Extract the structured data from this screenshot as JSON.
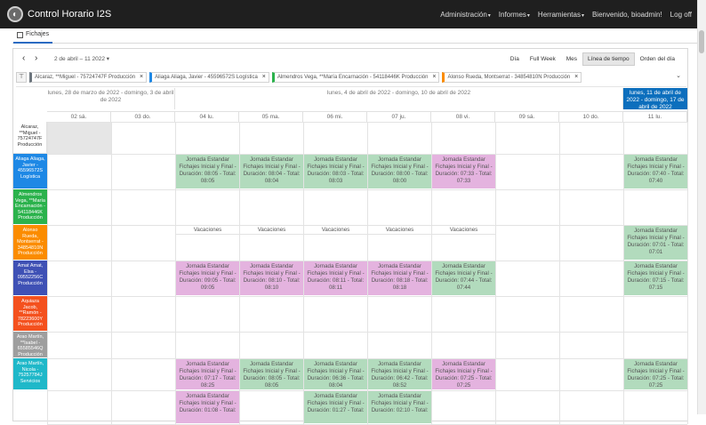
{
  "app": {
    "title": "Control Horario I2S"
  },
  "nav": [
    {
      "label": "Administración",
      "has_caret": true
    },
    {
      "label": "Informes",
      "has_caret": true
    },
    {
      "label": "Herramientas",
      "has_caret": true
    },
    {
      "label": "Bienvenido, bioadmin!",
      "has_caret": false
    },
    {
      "label": "Log off",
      "has_caret": false
    }
  ],
  "tabs": [
    {
      "label": "Fichajes",
      "icon": "clipboard-icon"
    }
  ],
  "toolbar": {
    "prev": "‹",
    "next": "›",
    "date_range": "2 de abril – 11 2022",
    "views": [
      {
        "label": "Día",
        "active": false
      },
      {
        "label": "Full Week",
        "active": false
      },
      {
        "label": "Mes",
        "active": false
      },
      {
        "label": "Línea de tiempo",
        "active": true
      },
      {
        "label": "Orden del día",
        "active": false
      }
    ]
  },
  "filters": [
    {
      "label": "Alcaraz, **Miguel - 75724747F Producción",
      "color": "#6c757d"
    },
    {
      "label": "Aliaga Aliaga, Javier - 45596572S Logística",
      "color": "#1e88e5"
    },
    {
      "label": "Almendros Vega, **María Encarnación - 54118446K Producción",
      "color": "#2bb24c"
    },
    {
      "label": "Alonso Rueda, Montserrat - 34854810N Producción",
      "color": "#fb8c00"
    }
  ],
  "weeks": [
    {
      "label": "lunes, 28 de marzo de 2022 - domingo, 3 de abril de 2022",
      "current": false
    },
    {
      "label": "lunes, 4 de abril de 2022 - domingo, 10 de abril de 2022",
      "current": false
    },
    {
      "label": "lunes, 11 de abril de 2022 - domingo, 17 de abril de 2022",
      "current": true
    }
  ],
  "days": [
    "02 sá.",
    "03 do.",
    "04 lu.",
    "05 ma.",
    "06 mi.",
    "07 ju.",
    "08 vi.",
    "09 sá.",
    "10 do.",
    "11 lu."
  ],
  "resources": [
    {
      "label": "Alcaraz, **Miguel - 75724747F Producción",
      "color": "#ffffff",
      "plain": true
    },
    {
      "label": "Aliaga Aliaga, Javier - 45596572S Logística",
      "color": "#1e88e5",
      "plain": false
    },
    {
      "label": "Almendros Vega, **María Encarnación - 54118446K Producción",
      "color": "#2bb24c",
      "plain": false
    },
    {
      "label": "Alonso Rueda, Montserrat - 34854810N Producción",
      "color": "#fb8c00",
      "plain": false
    },
    {
      "label": "Amat Amat, Elsa - 09552256C Producción",
      "color": "#3f51b5",
      "plain": false
    },
    {
      "label": "Aquiaza Jacob, **Ramón - 78223600Y Producción",
      "color": "#f4511e",
      "plain": false
    },
    {
      "label": "Arao Martín, **Isabel - 65585546Q Producción",
      "color": "#9e9e9e",
      "plain": false
    },
    {
      "label": "Arao Martín, Nicola - 75257784J Servicios",
      "color": "#1fb8c9",
      "plain": false
    }
  ],
  "events": [
    {
      "row": 1,
      "day": 2,
      "color": "green",
      "lines": [
        "Jornada Estandar",
        "Fichajes Inicial y Final -",
        "Duración: 08:05 - Total:",
        "08:05"
      ]
    },
    {
      "row": 1,
      "day": 3,
      "color": "green",
      "lines": [
        "Jornada Estandar",
        "Fichajes Inicial y Final -",
        "Duración: 08:04 - Total:",
        "08:04"
      ]
    },
    {
      "row": 1,
      "day": 4,
      "color": "green",
      "lines": [
        "Jornada Estandar",
        "Fichajes Inicial y Final -",
        "Duración: 08:03 - Total:",
        "08:03"
      ]
    },
    {
      "row": 1,
      "day": 5,
      "color": "green",
      "lines": [
        "Jornada Estandar",
        "Fichajes Inicial y Final -",
        "Duración: 08:00 - Total:",
        "08:00"
      ]
    },
    {
      "row": 1,
      "day": 6,
      "color": "pink",
      "lines": [
        "Jornada Estandar",
        "Fichajes Inicial y Final -",
        "Duración: 07:33 - Total:",
        "07:33"
      ]
    },
    {
      "row": 1,
      "day": 9,
      "color": "green",
      "lines": [
        "Jornada Estandar",
        "Fichajes Inicial y Final -",
        "Duración: 07:40 - Total:",
        "07:40"
      ]
    },
    {
      "row": 3,
      "day": 9,
      "color": "green",
      "lines": [
        "Jornada Estandar",
        "Fichajes Inicial y Final -",
        "Duración: 07:01 - Total:",
        "07:01"
      ]
    },
    {
      "row": 4,
      "day": 2,
      "color": "pink",
      "lines": [
        "Jornada Estandar",
        "Fichajes Inicial y Final -",
        "Duración: 09:05 - Total:",
        "09:05"
      ]
    },
    {
      "row": 4,
      "day": 3,
      "color": "pink",
      "lines": [
        "Jornada Estandar",
        "Fichajes Inicial y Final -",
        "Duración: 08:10 - Total:",
        "08:10"
      ]
    },
    {
      "row": 4,
      "day": 4,
      "color": "pink",
      "lines": [
        "Jornada Estandar",
        "Fichajes Inicial y Final -",
        "Duración: 08:11 - Total:",
        "08:11"
      ]
    },
    {
      "row": 4,
      "day": 5,
      "color": "pink",
      "lines": [
        "Jornada Estandar",
        "Fichajes Inicial y Final -",
        "Duración: 08:18 - Total:",
        "08:18"
      ]
    },
    {
      "row": 4,
      "day": 6,
      "color": "green",
      "lines": [
        "Jornada Estandar",
        "Fichajes Inicial y Final -",
        "Duración: 07:44 - Total:",
        "07:44"
      ]
    },
    {
      "row": 4,
      "day": 9,
      "color": "green",
      "lines": [
        "Jornada Estandar",
        "Fichajes Inicial y Final -",
        "Duración: 07:15 - Total:",
        "07:15"
      ]
    },
    {
      "row": 7,
      "day": 2,
      "color": "pink",
      "lines": [
        "Jornada Estandar",
        "Fichajes Inicial y Final -",
        "Duración: 07:17 - Total:",
        "08:25"
      ]
    },
    {
      "row": 7,
      "day": 3,
      "color": "green",
      "lines": [
        "Jornada Estandar",
        "Fichajes Inicial y Final -",
        "Duración: 08:05 - Total:",
        "08:05"
      ]
    },
    {
      "row": 7,
      "day": 4,
      "color": "green",
      "lines": [
        "Jornada Estandar",
        "Fichajes Inicial y Final -",
        "Duración: 06:36 - Total:",
        "08:04"
      ]
    },
    {
      "row": 7,
      "day": 5,
      "color": "green",
      "lines": [
        "Jornada Estandar",
        "Fichajes Inicial y Final -",
        "Duración: 06:42 - Total:",
        "08:52"
      ]
    },
    {
      "row": 7,
      "day": 6,
      "color": "pink",
      "lines": [
        "Jornada Estandar",
        "Fichajes Inicial y Final -",
        "Duración: 07:25 - Total:",
        "07:25"
      ]
    },
    {
      "row": 7,
      "day": 9,
      "color": "green",
      "lines": [
        "Jornada Estandar",
        "Fichajes Inicial y Final -",
        "Duración: 07:25 - Total:",
        "07:25"
      ]
    },
    {
      "row": 8,
      "day": 2,
      "color": "pink",
      "lines": [
        "Jornada Estandar",
        "Fichajes Inicial y Final -",
        "Duración: 01:08 - Total:"
      ]
    },
    {
      "row": 8,
      "day": 4,
      "color": "green",
      "lines": [
        "Jornada Estandar",
        "Fichajes Inicial y Final -",
        "Duración: 01:27 - Total:"
      ]
    },
    {
      "row": 8,
      "day": 5,
      "color": "green",
      "lines": [
        "Jornada Estandar",
        "Fichajes Inicial y Final -",
        "Duración: 02:10 - Total:"
      ]
    }
  ],
  "vacations": [
    {
      "row": 3,
      "day": 2,
      "label": "Vacaciones"
    },
    {
      "row": 3,
      "day": 3,
      "label": "Vacaciones"
    },
    {
      "row": 3,
      "day": 4,
      "label": "Vacaciones"
    },
    {
      "row": 3,
      "day": 5,
      "label": "Vacaciones"
    },
    {
      "row": 3,
      "day": 6,
      "label": "Vacaciones"
    }
  ]
}
